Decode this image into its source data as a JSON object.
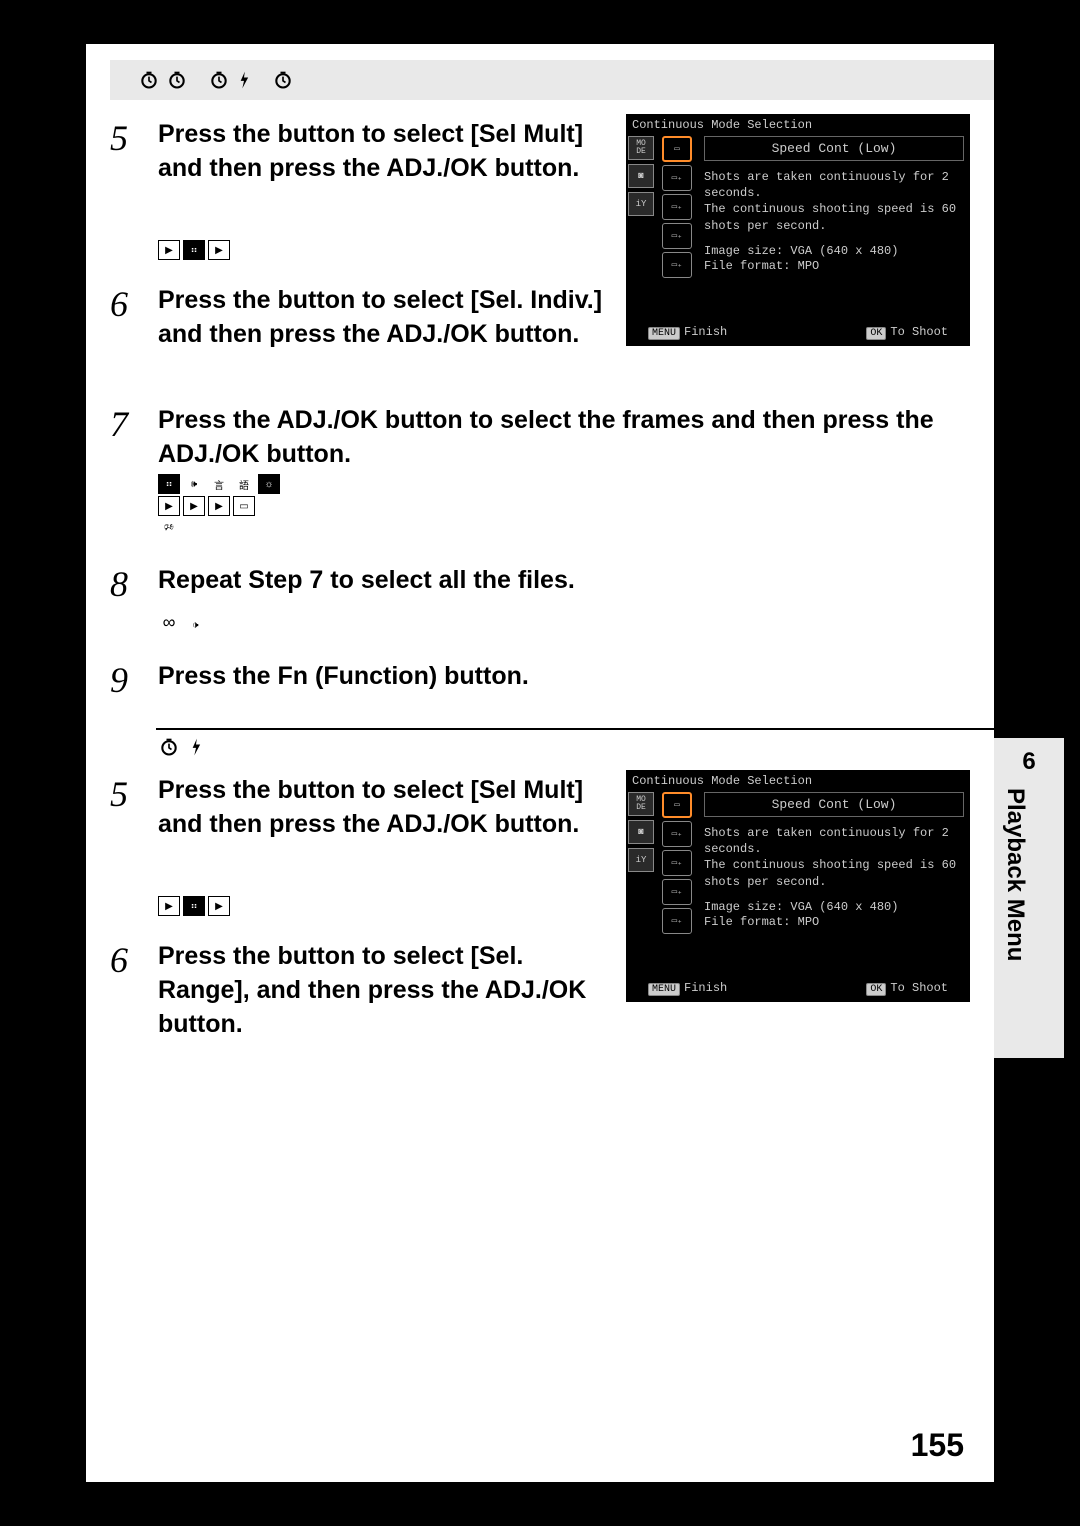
{
  "section_a": {
    "step5": {
      "num": "5",
      "text": "Press the button          to select [Sel Mult] and then press the ADJ./OK button."
    },
    "step6": {
      "num": "6",
      "text": "Press the button          to select [Sel. Indiv.] and then press the ADJ./OK button."
    },
    "step7": {
      "num": "7",
      "text": "Press the ADJ./OK button               to select the frames and then press the ADJ./OK button."
    },
    "step8": {
      "num": "8",
      "text": "Repeat Step 7 to select all the files."
    },
    "step9": {
      "num": "9",
      "text": "Press the Fn (Function) button."
    }
  },
  "section_b": {
    "step5": {
      "num": "5",
      "text": "Press the button          to select [Sel Mult] and then press the ADJ./OK button."
    },
    "step6": {
      "num": "6",
      "text": "Press the button          to select [Sel. Range], and then press the ADJ./OK button."
    }
  },
  "camera": {
    "title": "Continuous Mode Selection",
    "speed": "Speed Cont (Low)",
    "desc": "Shots are taken continuously for 2 seconds.\nThe continuous shooting speed is 60 shots per second.",
    "info1": "Image size: VGA (640 x 480)",
    "info2": "File format: MPO",
    "menu_label": "MENU",
    "finish": "Finish",
    "ok_label": "OK",
    "toshoot": "To Shoot",
    "left_mode": "MO\nDE"
  },
  "side": {
    "chapter": "6",
    "label": "Playback Menu"
  },
  "page_number": "155"
}
